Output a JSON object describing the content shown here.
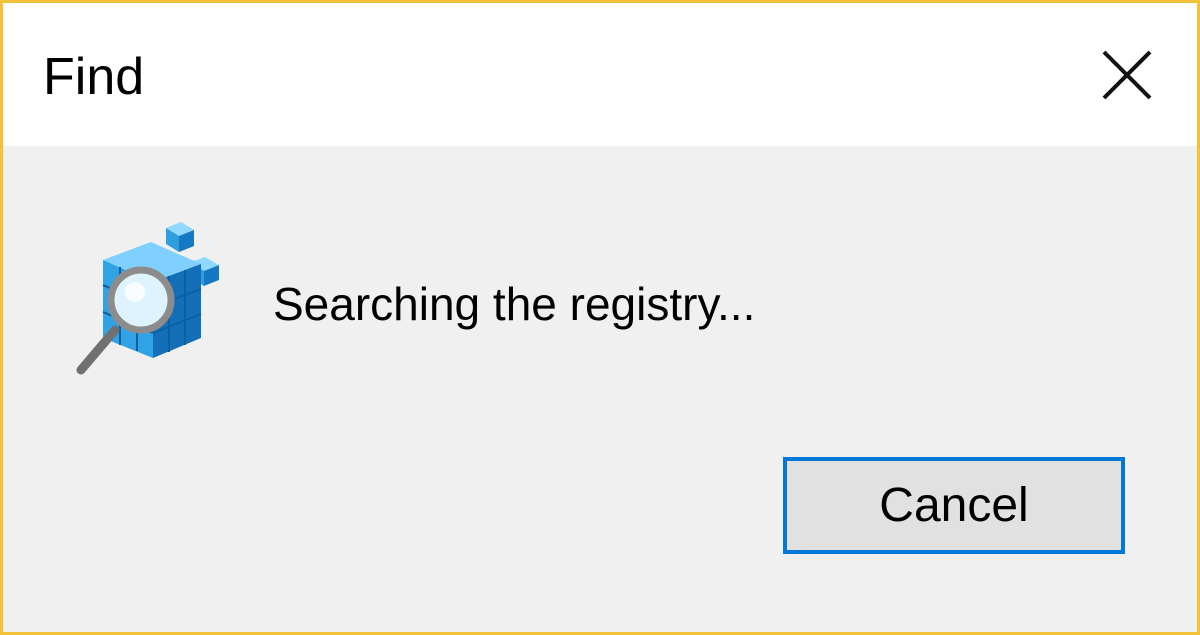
{
  "window": {
    "title": "Find",
    "border_color": "#f2c33a",
    "close_icon": "close-icon"
  },
  "dialog": {
    "icon": "registry-search-icon",
    "message": "Searching the registry...",
    "cancel_label": "Cancel",
    "accent": "#0078d7"
  }
}
